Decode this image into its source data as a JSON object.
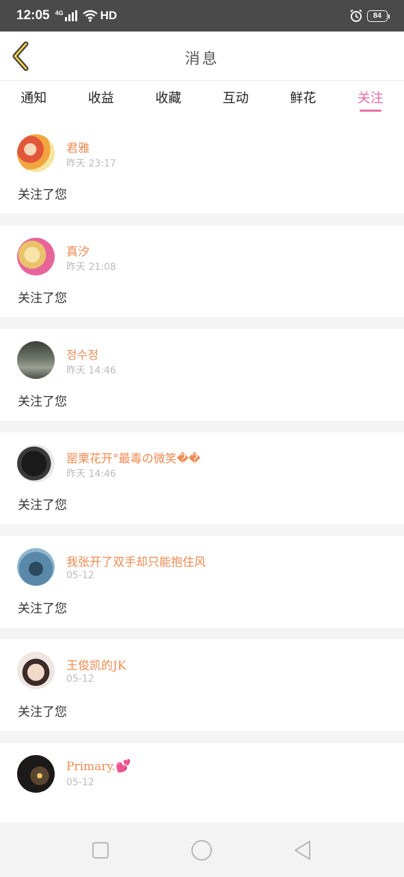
{
  "status_bar": {
    "time": "12:05",
    "network": "4G",
    "hd": "HD",
    "battery": "84"
  },
  "header": {
    "title": "消息"
  },
  "tabs": [
    {
      "label": "通知"
    },
    {
      "label": "收益"
    },
    {
      "label": "收藏"
    },
    {
      "label": "互动"
    },
    {
      "label": "鲜花"
    },
    {
      "label": "关注",
      "active": true
    }
  ],
  "colors": {
    "accent": "#e86aa8",
    "username": "#ef8a52",
    "time": "#bbbbbb"
  },
  "items": [
    {
      "name": "君雅",
      "time": "昨天 23:17",
      "action": "关注了您"
    },
    {
      "name": "真汐",
      "time": "昨天 21:08",
      "action": "关注了您"
    },
    {
      "name": "정수정",
      "time": "昨天 14:46",
      "action": "关注了您"
    },
    {
      "name": "罂栗花开°最毒の微笑��",
      "time": "昨天 14:46",
      "action": "关注了您"
    },
    {
      "name": "我张开了双手却只能抱住风",
      "time": "05-12",
      "action": "关注了您"
    },
    {
      "name": "王俊凯的JK",
      "time": "05-12",
      "action": "关注了您"
    },
    {
      "name": "Primary.",
      "time": "05-12",
      "action": "",
      "emoji": "💕"
    }
  ]
}
